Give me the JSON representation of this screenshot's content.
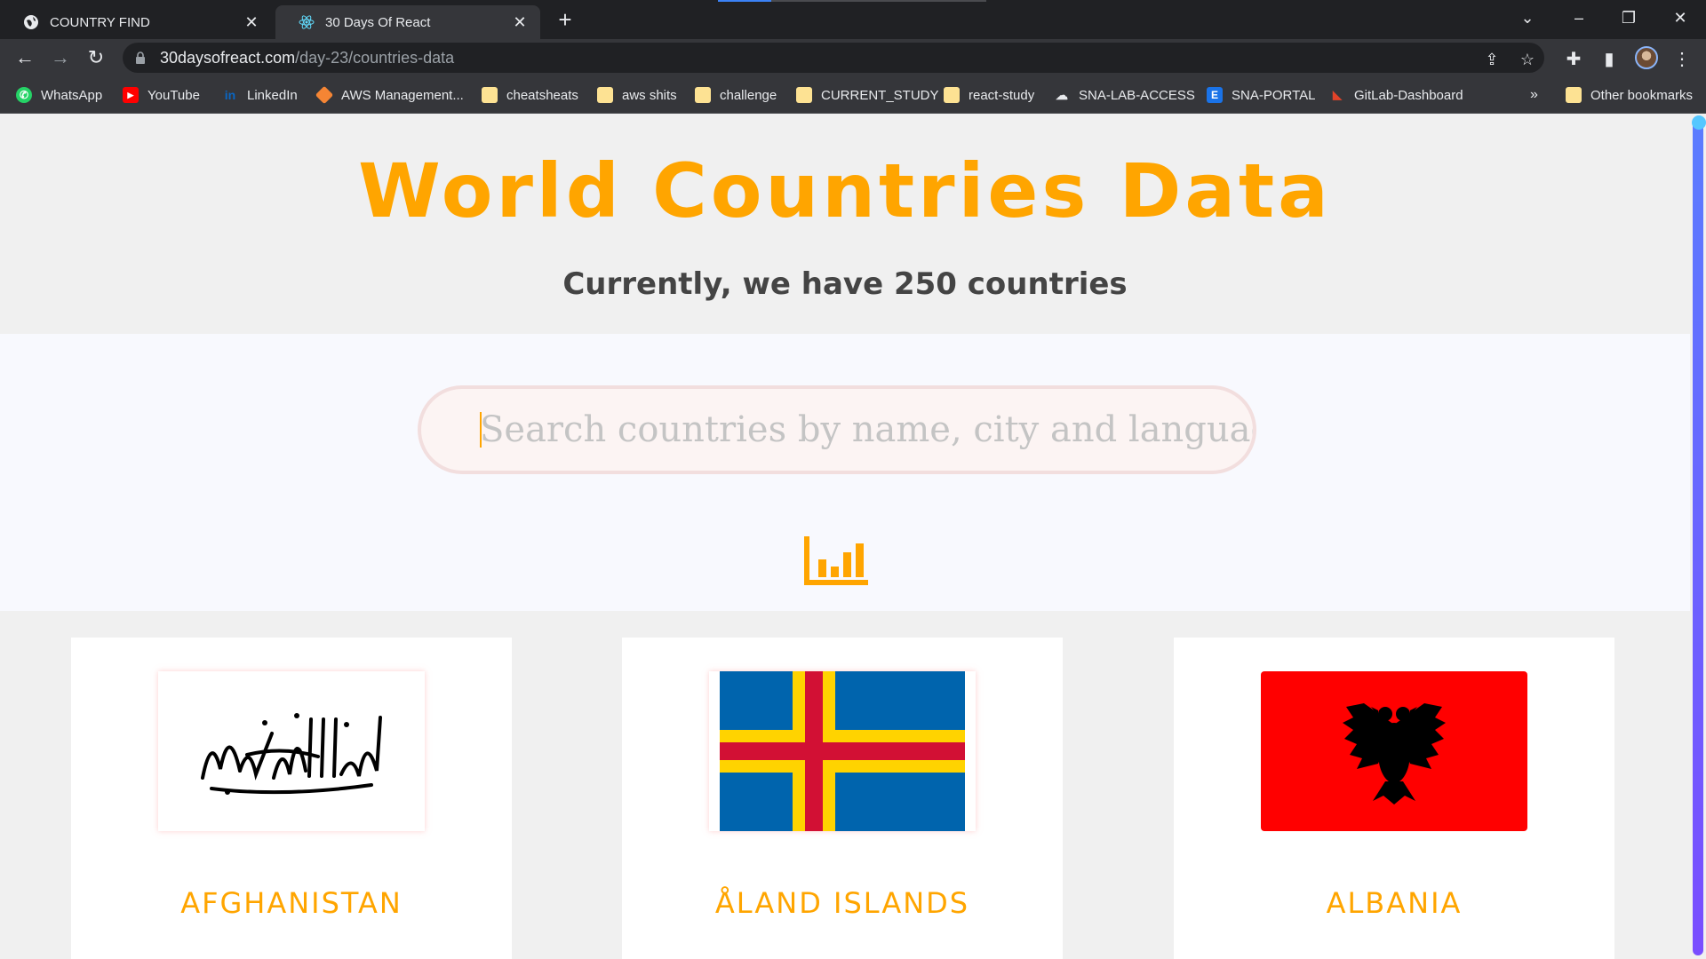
{
  "browser": {
    "tabs": [
      {
        "title": "COUNTRY FIND",
        "icon": "globe-icon",
        "active": false
      },
      {
        "title": "30 Days Of React",
        "icon": "react-icon",
        "active": true
      }
    ],
    "url_host": "30daysofreact.com",
    "url_path": "/day-23/countries-data",
    "bookmarks": [
      {
        "label": "WhatsApp",
        "icon": "whatsapp-icon"
      },
      {
        "label": "YouTube",
        "icon": "youtube-icon"
      },
      {
        "label": "LinkedIn",
        "icon": "linkedin-icon"
      },
      {
        "label": "AWS Management...",
        "icon": "aws-icon"
      },
      {
        "label": "cheatsheats",
        "icon": "folder-icon"
      },
      {
        "label": "aws shits",
        "icon": "folder-icon"
      },
      {
        "label": "challenge",
        "icon": "folder-icon"
      },
      {
        "label": "CURRENT_STUDY",
        "icon": "folder-icon"
      },
      {
        "label": "react-study",
        "icon": "folder-icon"
      },
      {
        "label": "SNA-LAB-ACCESS",
        "icon": "sna-icon"
      },
      {
        "label": "SNA-PORTAL",
        "icon": "e-icon"
      },
      {
        "label": "GitLab-Dashboard",
        "icon": "gitlab-icon"
      }
    ],
    "overflow_label": "»",
    "other_bookmarks": "Other bookmarks"
  },
  "header": {
    "title": "World Countries Data",
    "subtitle": "Currently, we have 250 countries"
  },
  "search": {
    "placeholder": "Search countries by name, city and languages",
    "value": ""
  },
  "countries": [
    {
      "name": "AFGHANISTAN",
      "flag": "afghanistan-flag"
    },
    {
      "name": "ÅLAND ISLANDS",
      "flag": "aland-islands-flag"
    },
    {
      "name": "ALBANIA",
      "flag": "albania-flag"
    }
  ],
  "colors": {
    "accent": "#ffa500",
    "subtitle": "#444444",
    "scrollbar": "#6a5cff"
  }
}
